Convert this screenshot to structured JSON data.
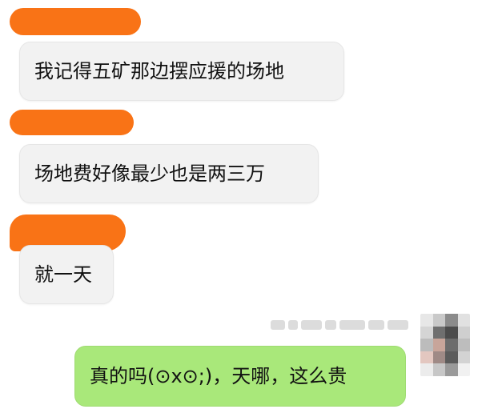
{
  "messages": [
    {
      "text": "我记得五矿那边摆应援的场地"
    },
    {
      "text": "场地费好像最少也是两三万"
    },
    {
      "text": "就一天"
    }
  ],
  "sent": {
    "text": "真的吗(⊙x⊙;)，天哪，这么贵"
  }
}
